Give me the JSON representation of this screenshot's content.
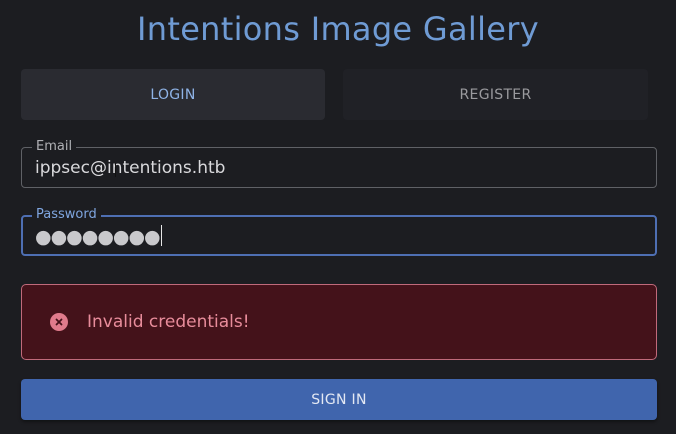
{
  "app": {
    "title": "Intentions Image Gallery"
  },
  "tabs": [
    {
      "label": "LOGIN",
      "active": true
    },
    {
      "label": "REGISTER",
      "active": false
    }
  ],
  "form": {
    "email": {
      "label": "Email",
      "value": "ippsec@intentions.htb"
    },
    "password": {
      "label": "Password",
      "masked_value": "●●●●●●●●"
    },
    "submit_label": "SIGN IN"
  },
  "alert": {
    "type": "error",
    "icon": "error-circle-x-icon",
    "message": "Invalid credentials!"
  },
  "colors": {
    "background": "#1c1d21",
    "title": "#6f9bd4",
    "accent": "#4065ad",
    "error_bg": "#44121a",
    "error_text": "#e88c9b"
  }
}
